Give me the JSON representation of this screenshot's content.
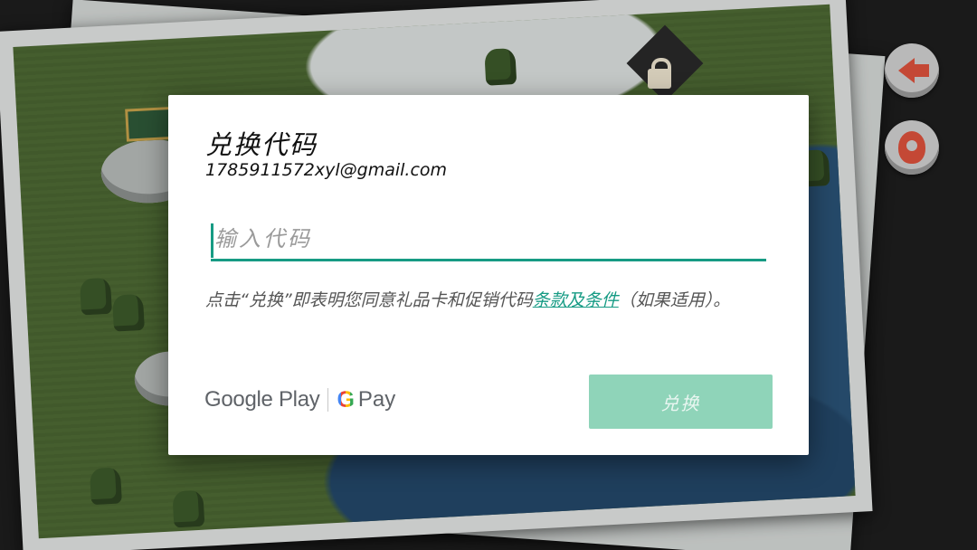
{
  "dialog": {
    "title": "兑换代码",
    "account_email": "1785911572xyl@gmail.com",
    "code_input": {
      "value": "",
      "placeholder": "输入代码"
    },
    "terms": {
      "prefix": "点击“兑换”即表明您同意礼品卡和促销代码",
      "link": "条款及条件",
      "suffix": "（如果适用）。"
    },
    "brand": {
      "google_play": "Google Play",
      "g_letter": "G",
      "pay": "Pay"
    },
    "redeem_button": "兑换"
  },
  "game": {
    "back_icon": "back-arrow-icon",
    "profile_icon": "character-icon",
    "lock_icon": "lock-icon"
  },
  "colors": {
    "accent": "#169b84",
    "button_disabled": "#8fd4b9",
    "arrow_red": "#e0533d"
  }
}
